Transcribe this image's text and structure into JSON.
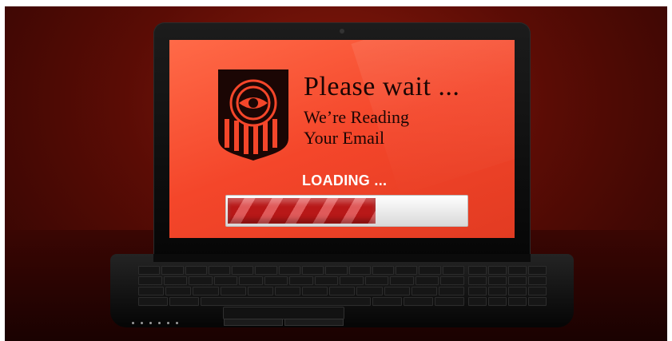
{
  "screen": {
    "title": "Please wait ...",
    "subtitle_line1": "We’re Reading",
    "subtitle_line2": "Your Email",
    "loading_label": "LOADING ...",
    "progress": 0.62
  },
  "logo": {
    "icon": "eye-shield-icon"
  },
  "colors": {
    "background": "#5a0c05",
    "screen": "#f4462a",
    "text_dark": "#1b0604",
    "progress_fill": "#b81818",
    "progress_track": "#e8e8e8"
  }
}
